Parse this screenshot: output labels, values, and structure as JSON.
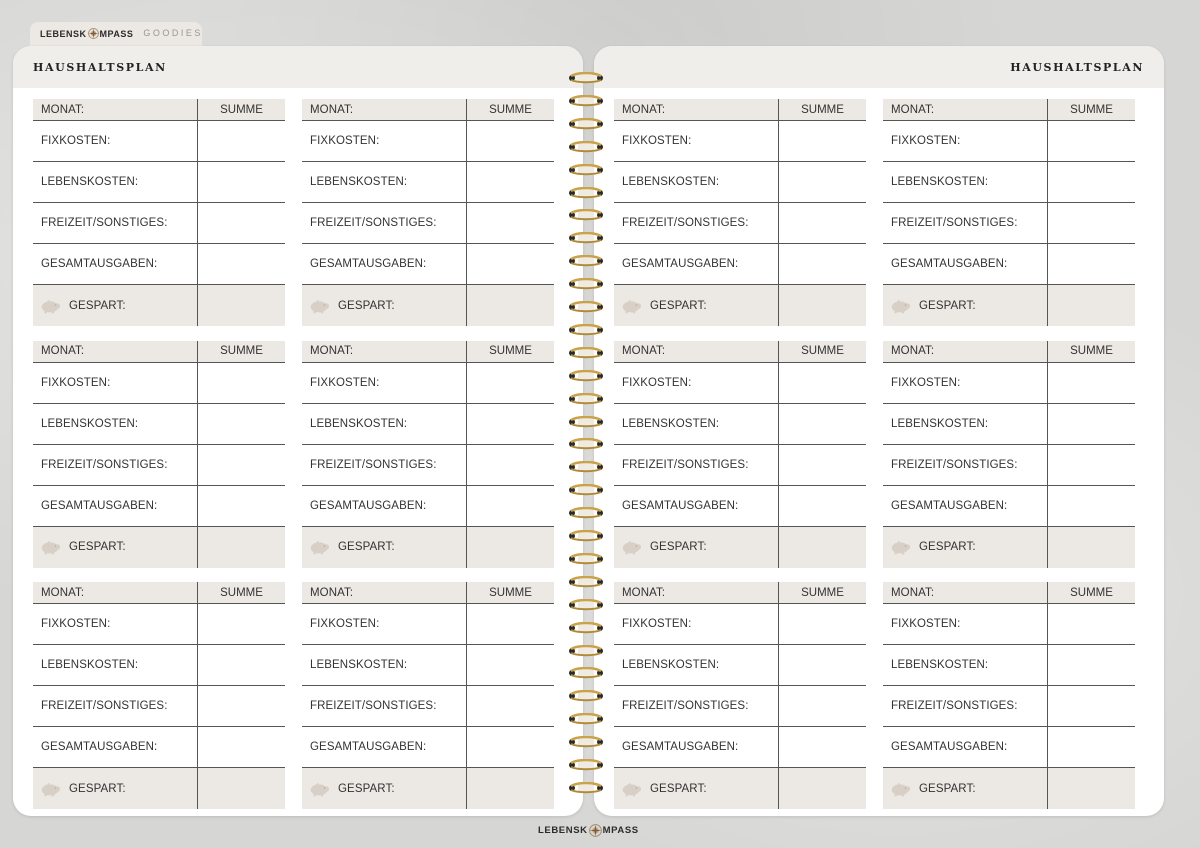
{
  "brand": {
    "name_part1": "LEBENSK",
    "name_part2": "MPASS",
    "goodies": "GOODIES"
  },
  "left_page": {
    "title": "HAUSHALTSPLAN"
  },
  "right_page": {
    "title": "HAUSHALTSPLAN"
  },
  "budget_block": {
    "month_label": "MONAT:",
    "sum_label": "SUMME",
    "rows": [
      "FIXKOSTEN:",
      "LEBENSKOSTEN:",
      "FREIZEIT/SONSTIGES:",
      "GESAMTAUSGABEN:"
    ],
    "saved_label": "GESPART:"
  },
  "blocks_per_page": 6,
  "icons": {
    "compass": "compass-icon",
    "piggy_bank": "piggy-bank-icon",
    "spiral": "spiral-binding"
  },
  "colors": {
    "accent_beige": "#ece8e3",
    "line": "#555555",
    "ring_gold": "#c9a24a",
    "piggy": "#d8cfc6"
  }
}
